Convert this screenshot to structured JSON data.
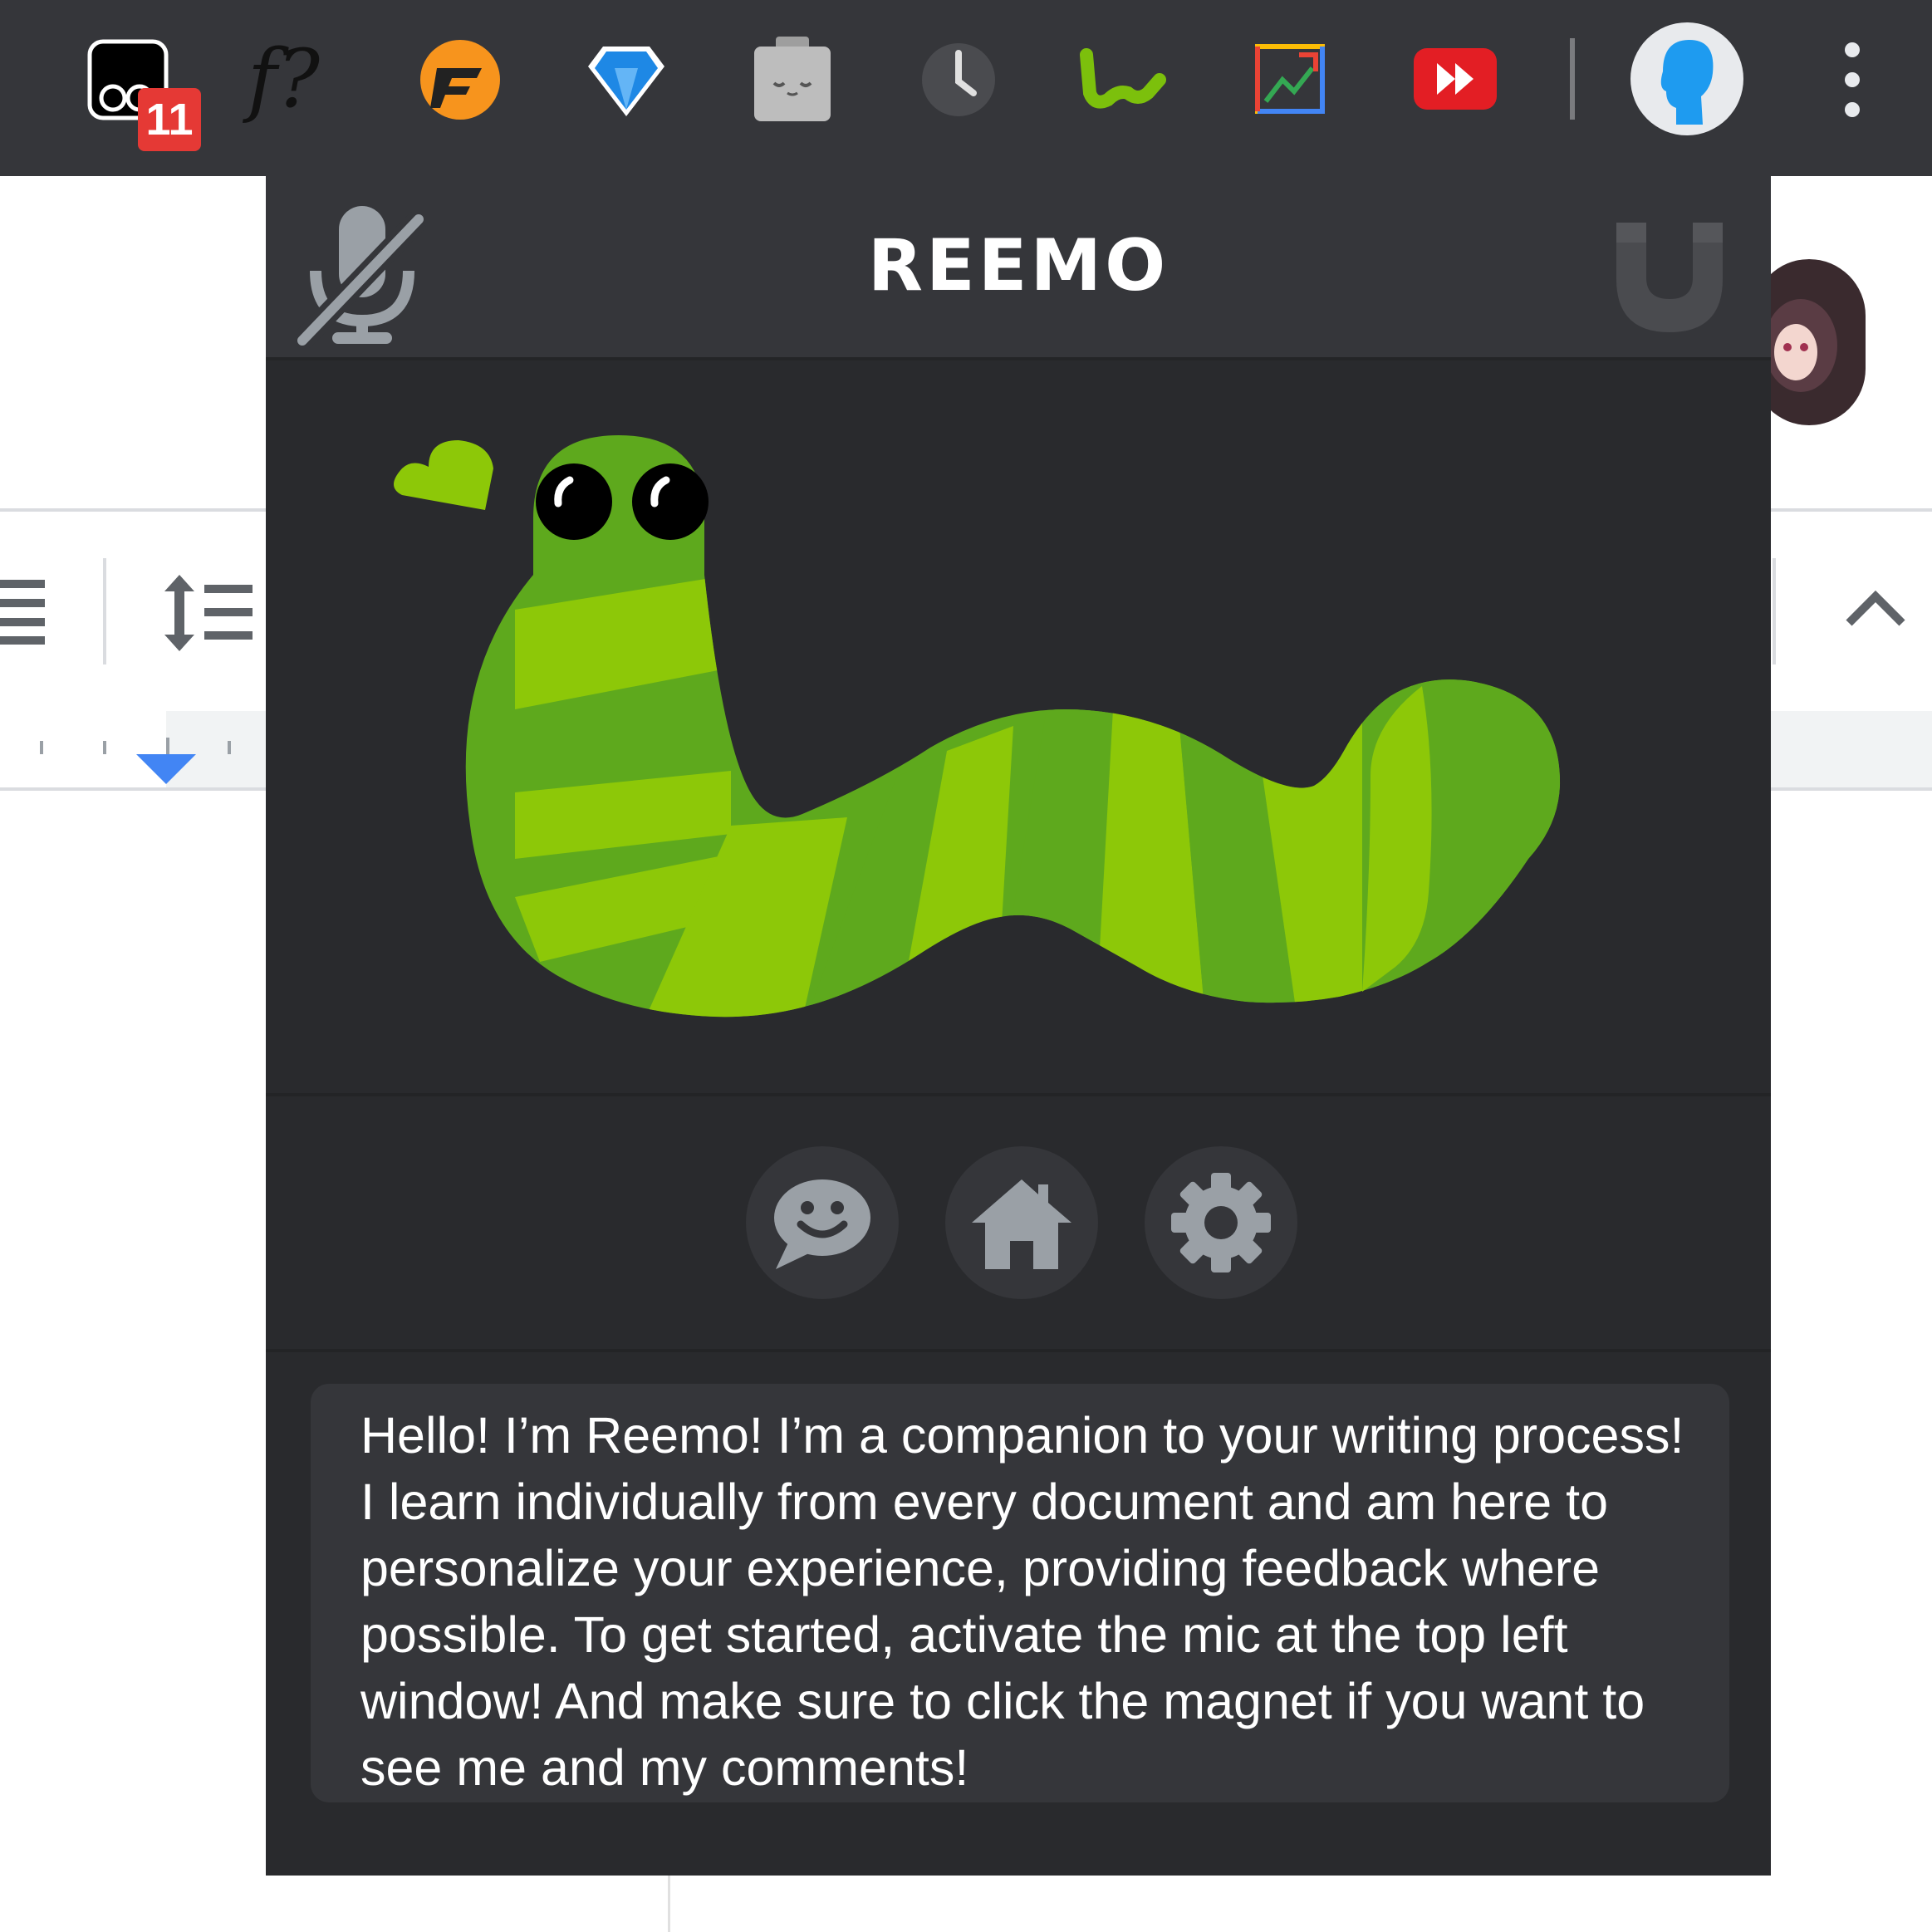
{
  "toolbar": {
    "extensions": [
      {
        "icon": "screen-recorder-icon",
        "badge": "11"
      },
      {
        "icon": "font-finder-icon",
        "text": "f?"
      },
      {
        "icon": "orange-f-extension-icon"
      },
      {
        "icon": "diamond-extension-icon"
      },
      {
        "icon": "sleeping-tab-extension-icon"
      },
      {
        "icon": "clock-extension-icon"
      },
      {
        "icon": "reemo-worm-extension-icon"
      },
      {
        "icon": "image-chart-extension-icon"
      },
      {
        "icon": "fast-forward-extension-icon"
      }
    ],
    "profile_icon": "profile-avatar-icon",
    "menu_icon": "kebab-menu-icon"
  },
  "popup": {
    "title": "REEMO",
    "mic_state": "muted",
    "nav": [
      {
        "label": "chat",
        "icon": "chat-bubble-icon"
      },
      {
        "label": "home",
        "icon": "home-icon"
      },
      {
        "label": "settings",
        "icon": "gear-icon"
      }
    ],
    "message": "Hello! I’m Reemo! I’m a companion to your writing process! I learn individually from every document and am here to personalize your experience, providing feedback where possible. To get started, activate the mic at the top left window! And make sure to click the magnet if you want to see me and my comments!"
  },
  "colors": {
    "toolbar_bg": "#35363a",
    "popup_bg": "#292a2d",
    "worm_light": "#8dc808",
    "worm_dark": "#5ea91d",
    "accent_blue": "#4285f4"
  }
}
